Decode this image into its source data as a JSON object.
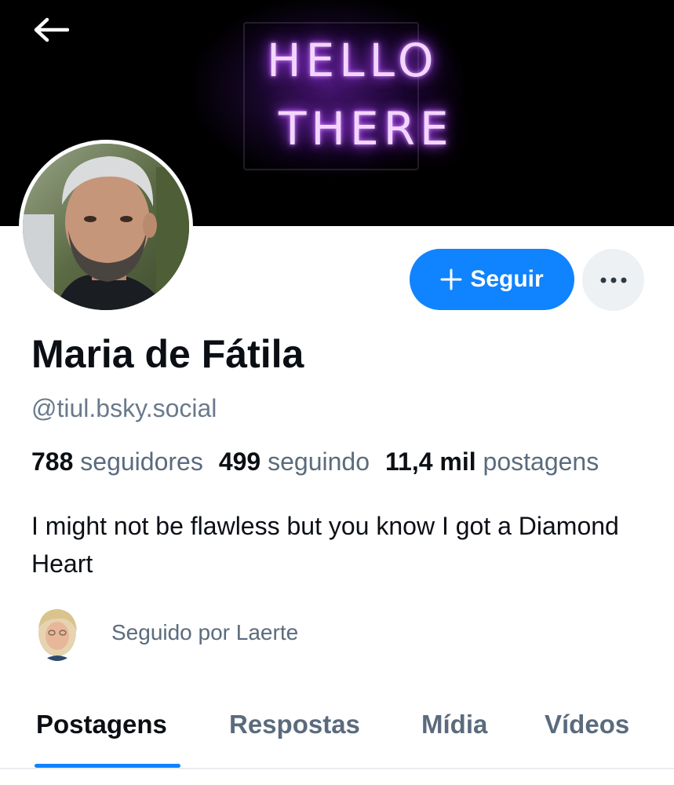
{
  "header": {
    "back_icon": "arrow-left-icon",
    "banner_text_line1": "HELLO",
    "banner_text_line2": "THERE"
  },
  "profile": {
    "display_name": "Maria de Fátila",
    "handle": "@tiul.bsky.social",
    "bio": "I might not be flawless but you know I got a Diamond Heart",
    "stats": {
      "followers_count": "788",
      "followers_label": "seguidores",
      "following_count": "499",
      "following_label": "seguindo",
      "posts_count": "11,4 mil",
      "posts_label": "postagens"
    },
    "followed_by": "Seguido por Laerte"
  },
  "actions": {
    "follow_label": "Seguir",
    "follow_icon": "plus-icon",
    "more_icon": "ellipsis-icon"
  },
  "tabs": [
    {
      "label": "Postagens",
      "active": true
    },
    {
      "label": "Respostas",
      "active": false
    },
    {
      "label": "Mídia",
      "active": false
    },
    {
      "label": "Vídeos",
      "active": false
    }
  ],
  "colors": {
    "accent": "#1083fe",
    "muted_text": "#5b6b7d",
    "banner_bg": "#000000",
    "neon": "#b040ff"
  }
}
